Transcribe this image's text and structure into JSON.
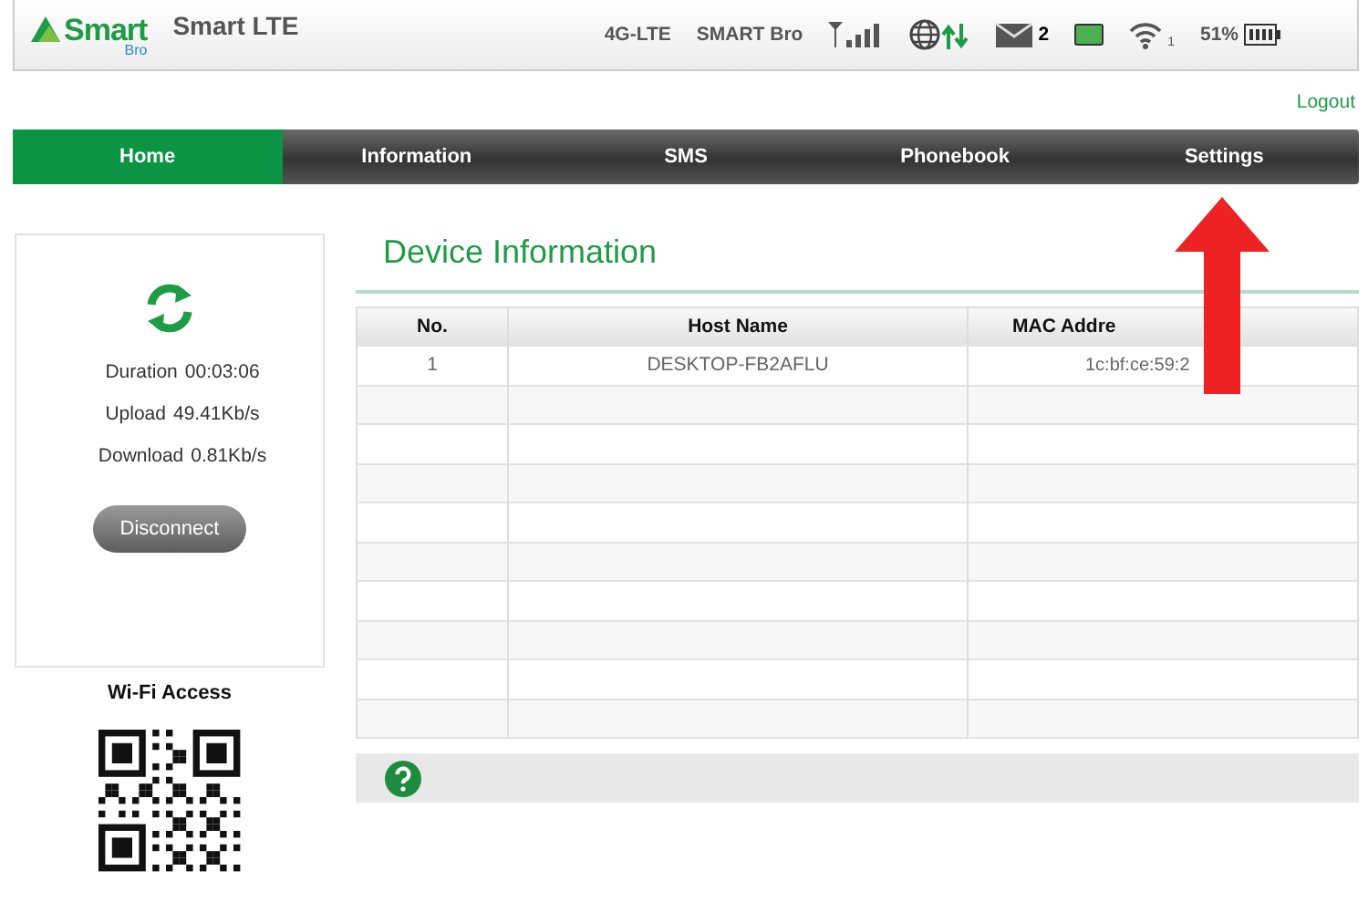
{
  "header": {
    "logo": {
      "name": "Smart",
      "sub": "Bro"
    },
    "title": "Smart LTE",
    "status": [
      {
        "kind": "text",
        "text": "4G-LTE"
      },
      {
        "kind": "text",
        "text": "SMART Bro"
      },
      {
        "kind": "signal"
      },
      {
        "kind": "globe"
      },
      {
        "kind": "mail",
        "text": "2"
      },
      {
        "kind": "sim"
      },
      {
        "kind": "wifi",
        "text": "1"
      },
      {
        "kind": "battery",
        "text": "51%"
      }
    ]
  },
  "logout": "Logout",
  "nav": [
    {
      "label": "Home",
      "selected": true
    },
    {
      "label": "Information",
      "selected": false
    },
    {
      "label": "SMS",
      "selected": false
    },
    {
      "label": "Phonebook",
      "selected": false
    },
    {
      "label": "Settings",
      "selected": false
    }
  ],
  "connection": {
    "stats": [
      {
        "label": "Duration",
        "value": "00:03:06"
      },
      {
        "label": "Upload",
        "value": "49.41Kb/s"
      },
      {
        "label": "Download",
        "value": "0.81Kb/s"
      }
    ],
    "button": "Disconnect"
  },
  "wifi_access": {
    "title": "Wi-Fi Access"
  },
  "device_info": {
    "title": "Device Information",
    "columns": [
      "No.",
      "Host Name",
      "MAC Addre"
    ],
    "rows": [
      {
        "cells": [
          "1",
          "DESKTOP-FB2AFLU",
          "1c:bf:ce:59:2"
        ]
      }
    ]
  },
  "annotation": {
    "kind": "arrow"
  }
}
